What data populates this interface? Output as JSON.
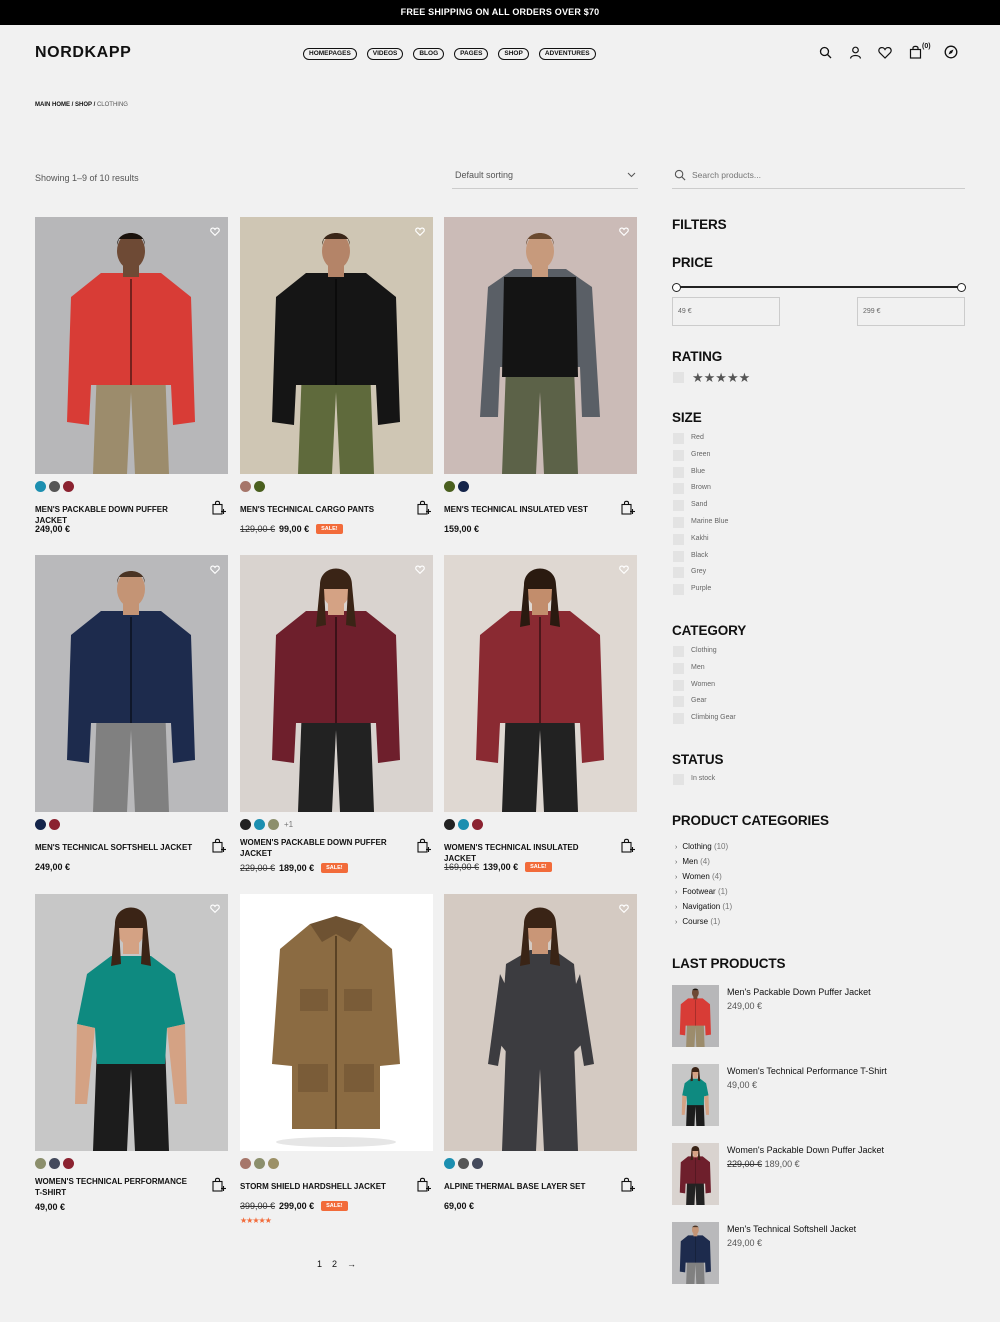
{
  "topbar": {
    "text": "FREE SHIPPING ON ALL ORDERS OVER $70"
  },
  "header": {
    "logo": "NORDKAPP",
    "nav": [
      "HOMEPAGES",
      "VIDEOS",
      "BLOG",
      "PAGES",
      "SHOP",
      "ADVENTURES"
    ],
    "cart_count": "(0)"
  },
  "breadcrumb": {
    "home": "MAIN HOME",
    "shop": "SHOP",
    "current": "CLOTHING",
    "sep": "/"
  },
  "toolbar": {
    "results": "Showing 1–9 of 10 results",
    "sorting": "Default sorting"
  },
  "products": [
    {
      "name": "MEN'S PACKABLE DOWN PUFFER JACKET",
      "price": "249,00 €",
      "old_price": "",
      "sale": "",
      "swatches": [
        "#1c8fb0",
        "#555555",
        "#8b2230"
      ],
      "more": ""
    },
    {
      "name": "MEN'S TECHNICAL CARGO PANTS",
      "price": "99,00 €",
      "old_price": "129,00 €",
      "sale": "SALE!",
      "swatches": [
        "#a6766a",
        "#4a5f1e"
      ],
      "more": ""
    },
    {
      "name": "MEN'S TECHNICAL INSULATED VEST",
      "price": "159,00 €",
      "old_price": "",
      "sale": "",
      "swatches": [
        "#4a5f1e",
        "#14244a"
      ],
      "more": ""
    },
    {
      "name": "MEN'S TECHNICAL SOFTSHELL JACKET",
      "price": "249,00 €",
      "old_price": "",
      "sale": "",
      "swatches": [
        "#14244a",
        "#8b2230"
      ],
      "more": ""
    },
    {
      "name": "WOMEN'S PACKABLE DOWN PUFFER JACKET",
      "price": "189,00 €",
      "old_price": "229,00 €",
      "sale": "SALE!",
      "swatches": [
        "#222222",
        "#1c8fb0",
        "#8c8f6c"
      ],
      "more": "+1"
    },
    {
      "name": "WOMEN'S TECHNICAL INSULATED JACKET",
      "price": "139,00 €",
      "old_price": "169,00 €",
      "sale": "SALE!",
      "swatches": [
        "#222222",
        "#1c8fb0",
        "#8b2230"
      ],
      "more": ""
    },
    {
      "name": "WOMEN'S TECHNICAL PERFORMANCE T-SHIRT",
      "price": "49,00 €",
      "old_price": "",
      "sale": "",
      "swatches": [
        "#8c8f6c",
        "#444a5c",
        "#8b2230"
      ],
      "more": ""
    },
    {
      "name": "STORM SHIELD HARDSHELL JACKET",
      "price": "299,00 €",
      "old_price": "399,00 €",
      "sale": "SALE!",
      "swatches": [
        "#a6766a",
        "#8c8f6c",
        "#9c9066"
      ],
      "more": "",
      "stars": "★★★★★"
    },
    {
      "name": "ALPINE THERMAL BASE LAYER SET",
      "price": "69,00 €",
      "old_price": "",
      "sale": "",
      "swatches": [
        "#1c8fb0",
        "#555555",
        "#444a5c"
      ],
      "more": ""
    }
  ],
  "pagination": {
    "p1": "1",
    "p2": "2",
    "next": "→"
  },
  "sidebar": {
    "search_placeholder": "Search products...",
    "filters": "FILTERS",
    "price": {
      "heading": "PRICE",
      "min": "49 €",
      "max": "299 €"
    },
    "rating": {
      "heading": "RATING",
      "stars": "★★★★★"
    },
    "size": {
      "heading": "SIZE",
      "items": [
        "Red",
        "Green",
        "Blue",
        "Brown",
        "Sand",
        "Marine Blue",
        "Kakhi",
        "Black",
        "Grey",
        "Purple"
      ]
    },
    "category": {
      "heading": "CATEGORY",
      "items": [
        "Clothing",
        "Men",
        "Women",
        "Gear",
        "Climbing Gear"
      ]
    },
    "status": {
      "heading": "STATUS",
      "items": [
        "In stock"
      ]
    },
    "product_categories": {
      "heading": "PRODUCT CATEGORIES",
      "items": [
        {
          "name": "Clothing",
          "count": "(10)"
        },
        {
          "name": "Men",
          "count": "(4)"
        },
        {
          "name": "Women",
          "count": "(4)"
        },
        {
          "name": "Footwear",
          "count": "(1)"
        },
        {
          "name": "Navigation",
          "count": "(1)"
        },
        {
          "name": "Course",
          "count": "(1)"
        }
      ]
    },
    "last_products": {
      "heading": "LAST PRODUCTS",
      "items": [
        {
          "name": "Men's Packable Down Puffer Jacket",
          "price": "249,00 €",
          "old_price": ""
        },
        {
          "name": "Women's Technical Performance T-Shirt",
          "price": "49,00 €",
          "old_price": ""
        },
        {
          "name": "Women's Packable Down Puffer Jacket",
          "price": "189,00 €",
          "old_price": "229,00 €"
        },
        {
          "name": "Men's Technical Softshell Jacket",
          "price": "249,00 €",
          "old_price": ""
        }
      ]
    }
  }
}
